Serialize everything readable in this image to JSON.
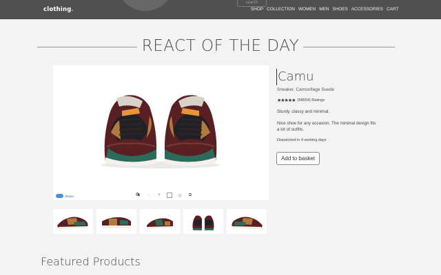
{
  "nav": {
    "brand": "clothing",
    "brand_suffix": ".",
    "search_label": "search",
    "items": [
      "SHOP",
      "COLLECTION",
      "WOMEN",
      "MEN",
      "SHOES",
      "ACCESSORIES",
      "CART"
    ]
  },
  "hero": {
    "title": "REACT OF THE DAY"
  },
  "viewer": {
    "badge": "3Dsee",
    "tools": [
      "square-icon",
      "minus-icon",
      "plus-icon",
      "zoom-icon",
      "rotate-icon",
      "fullscreen-icon"
    ]
  },
  "product": {
    "name": "Camu",
    "subtitle": "Sneaker, Camouflage Suede",
    "rating_stars": 5,
    "rating_text": "(58654) Ratings",
    "tagline": "Sturdy, classy and minimal.",
    "description": "Nice shoe for any occasion. The minimal design fits a lot of outfits.",
    "shipping": "Dispatched in 4 working days",
    "add_button": "Add to basket"
  },
  "thumbnails": [
    "shoe-view-1",
    "shoe-view-2",
    "shoe-view-3",
    "shoe-view-4",
    "shoe-view-5"
  ],
  "featured": {
    "title": "Featured Products"
  },
  "colors": {
    "nav_bg": "#505050",
    "page_bg": "#f3f3f3",
    "shoe_suede": "#5a1f22",
    "shoe_accent": "#2b6b5c",
    "shoe_tan": "#b07a3c"
  }
}
